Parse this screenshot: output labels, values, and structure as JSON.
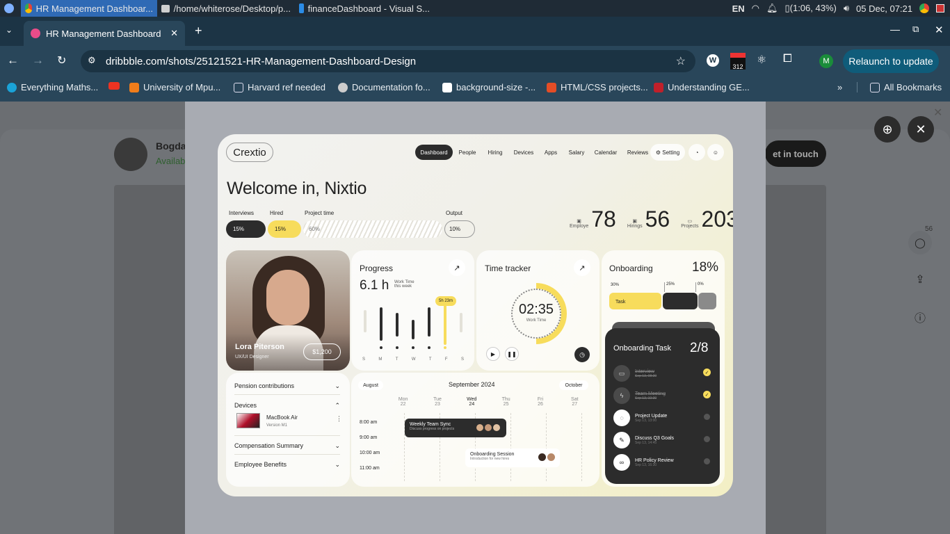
{
  "os": {
    "tasks": [
      "HR Management Dashboar...",
      "/home/whiterose/Desktop/p...",
      "financeDashboard - Visual S..."
    ],
    "lang": "EN",
    "battery": "(1:06, 43%)",
    "clock": "05 Dec, 07:21"
  },
  "browser": {
    "tab_title": "HR Management Dashboard",
    "url": "dribbble.com/shots/25121521-HR-Management-Dashboard-Design",
    "ext_badge": "312",
    "profile_initial": "M",
    "relaunch": "Relaunch to update",
    "bookmarks": [
      "Everything Maths...",
      "University of Mpu...",
      "Harvard ref needed",
      "Documentation fo...",
      "background-size -...",
      "HTML/CSS projects...",
      "Understanding GE..."
    ],
    "all_bookmarks": "All Bookmarks"
  },
  "behind": {
    "author": "Bogda",
    "status": "Availab",
    "get_in_touch": "et in touch",
    "comments": "56"
  },
  "dash": {
    "logo": "Crextio",
    "nav": [
      "Dashboard",
      "People",
      "Hiring",
      "Devices",
      "Apps",
      "Salary",
      "Calendar",
      "Reviews"
    ],
    "setting": "Setting",
    "welcome": "Welcome in, Nixtio",
    "metrics": {
      "interviews_label": "Interviews",
      "interviews": "15%",
      "hired_label": "Hired",
      "hired": "15%",
      "project_label": "Project time",
      "project": "60%",
      "output_label": "Output",
      "output": "10%"
    },
    "stats": [
      {
        "value": "78",
        "label": "Employe"
      },
      {
        "value": "56",
        "label": "Hirings"
      },
      {
        "value": "203",
        "label": "Projects"
      }
    ],
    "profile": {
      "name": "Lora Piterson",
      "role": "UX/UI Designer",
      "salary": "$1,200"
    },
    "progress": {
      "title": "Progress",
      "hours": "6.1 h",
      "caption1": "Work Time",
      "caption2": "this week",
      "badge": "5h 23m",
      "days": [
        "S",
        "M",
        "T",
        "W",
        "T",
        "F",
        "S"
      ]
    },
    "timer": {
      "title": "Time tracker",
      "time": "02:35",
      "caption": "Work Time"
    },
    "onboarding": {
      "title": "Onboarding",
      "percent": "18%",
      "segments": [
        "30%",
        "25%",
        "0%"
      ],
      "task_label": "Task",
      "panel_title": "Onboarding Task",
      "panel_count": "2/8",
      "tasks": [
        {
          "name": "Interview",
          "date": "Sep 13, 08:30",
          "done": true,
          "icon": "monitor-icon"
        },
        {
          "name": "Team Meeting",
          "date": "Sep 13, 10:30",
          "done": true,
          "icon": "bolt-icon"
        },
        {
          "name": "Project Update",
          "date": "Sep 13, 13:00",
          "done": false,
          "icon": "chat-icon"
        },
        {
          "name": "Discuss Q3 Goals",
          "date": "Sep 13, 14:45",
          "done": false,
          "icon": "pencil-icon"
        },
        {
          "name": "HR Policy Review",
          "date": "Sep 13, 16:30",
          "done": false,
          "icon": "link-icon"
        }
      ]
    },
    "accordion": [
      "Pension contributions",
      "Devices",
      "Compensation Summary",
      "Employee Benefits"
    ],
    "device": {
      "name": "MacBook Air",
      "version": "Version M1"
    },
    "calendar": {
      "prev": "August",
      "month": "September 2024",
      "next": "October",
      "days": [
        {
          "d": "Mon",
          "n": "22"
        },
        {
          "d": "Tue",
          "n": "23"
        },
        {
          "d": "Wed",
          "n": "24"
        },
        {
          "d": "Thu",
          "n": "25"
        },
        {
          "d": "Fri",
          "n": "26"
        },
        {
          "d": "Sat",
          "n": "27"
        }
      ],
      "times": [
        "8:00 am",
        "9:00 am",
        "10:00 am",
        "11:00 am"
      ],
      "events": [
        {
          "title": "Weekly Team Sync",
          "sub": "Discuss progress on projects"
        },
        {
          "title": "Onboarding Session",
          "sub": "Introduction for new hires"
        }
      ]
    }
  }
}
